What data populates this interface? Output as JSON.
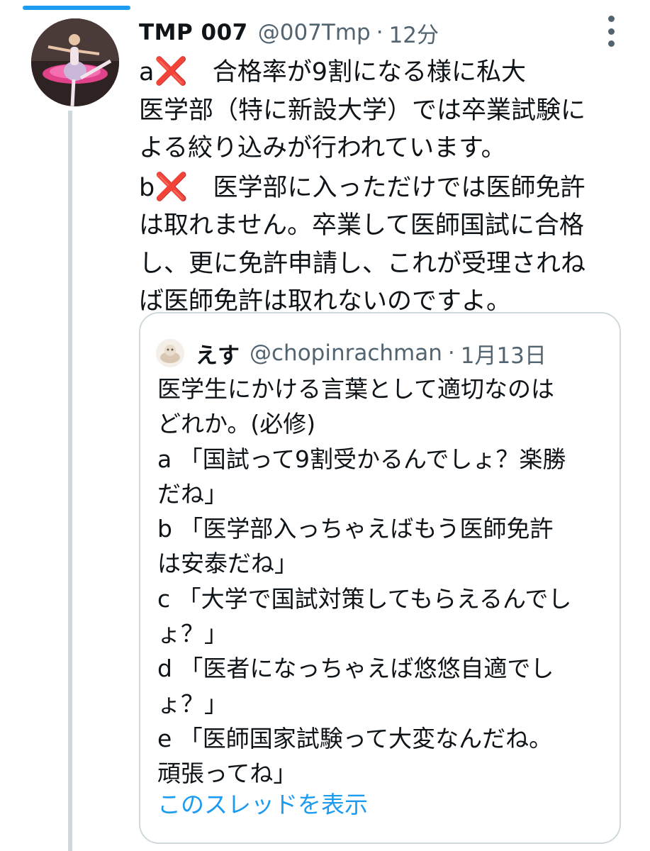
{
  "tweet": {
    "display_name": "TMP 007",
    "handle": "@007Tmp",
    "separator": "·",
    "time": "12分",
    "body_lines": [
      {
        "prefix": "a",
        "mark": "❌",
        "text": "　合格率が9割になる様に私大"
      },
      {
        "prefix": "",
        "mark": "",
        "text": "医学部（特に新設大学）では卒業試験に"
      },
      {
        "prefix": "",
        "mark": "",
        "text": "よる絞り込みが行われています。"
      },
      {
        "prefix": "b",
        "mark": "❌",
        "text": "　医学部に入っただけでは医師免許"
      },
      {
        "prefix": "",
        "mark": "",
        "text": "は取れません。卒業して医師国試に合格"
      },
      {
        "prefix": "",
        "mark": "",
        "text": "し、更に免許申請し、これが受理されね"
      },
      {
        "prefix": "",
        "mark": "",
        "text": "ば医師免許は取れないのですよ。"
      }
    ]
  },
  "quote": {
    "display_name": "えす",
    "handle": "@chopinrachman",
    "separator": "·",
    "time": "1月13日",
    "body_lines": [
      "医学生にかける言葉として適切なのは",
      "どれか。(必修)",
      "a 「国試って9割受かるんでしょ？楽勝",
      "だね」",
      "b 「医学部入っちゃえばもう医師免許",
      "は安泰だね」",
      "c 「大学で国試対策してもらえるんでし",
      "ょ？」",
      "d 「医者になっちゃえば悠悠自適でし",
      "ょ？」",
      "e 「医師国家試験って大変なんだね。",
      "頑張ってね」"
    ],
    "show_thread_label": "このスレッドを表示"
  },
  "colors": {
    "accent": "#1d9bf0",
    "text_primary": "#0f1419",
    "text_secondary": "#536471",
    "border": "#cfd9de",
    "cross_mark": "#d01c1c"
  },
  "icons": {
    "more": "more-vertical-icon",
    "cross": "cross-mark-icon"
  }
}
